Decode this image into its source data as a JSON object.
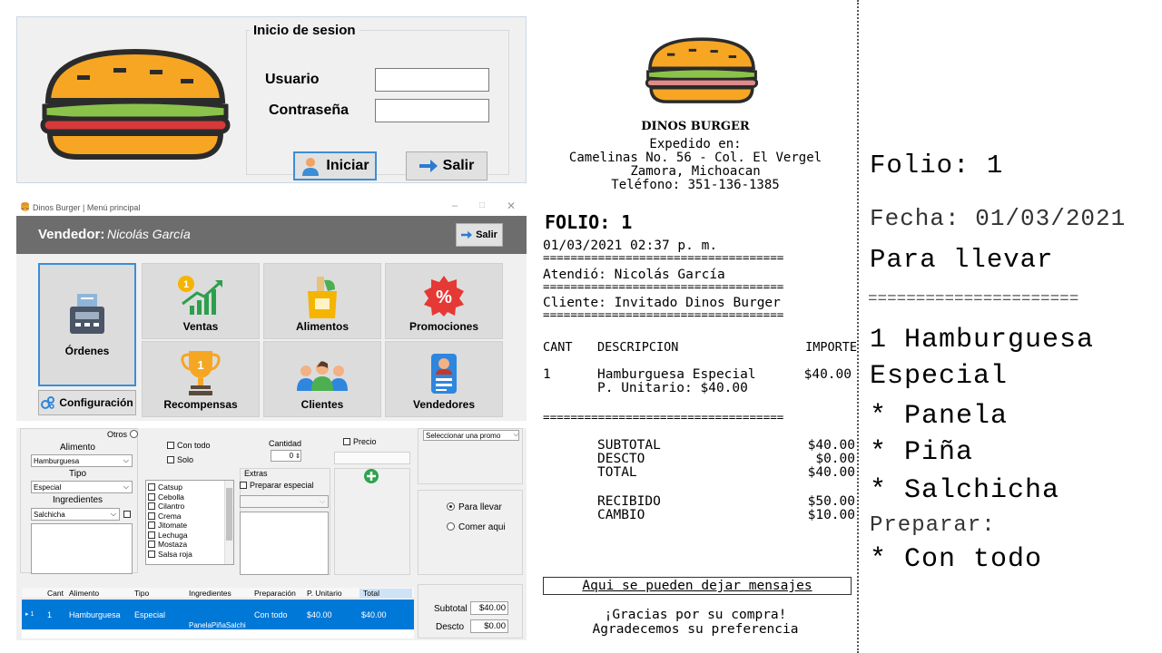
{
  "login": {
    "title": "Inicio de sesion",
    "user_label": "Usuario",
    "password_label": "Contraseña",
    "user_value": "",
    "password_value": "",
    "login_button": "Iniciar",
    "exit_button": "Salir"
  },
  "menu": {
    "window_title": "Dinos Burger | Menú principal",
    "seller_label": "Vendedor:",
    "seller_name": "Nicolás García",
    "exit_button": "Salir",
    "tiles": {
      "orders": "Órdenes",
      "sales": "Ventas",
      "sales_badge": "1",
      "foods": "Alimentos",
      "promos": "Promociones",
      "rewards": "Recompensas",
      "clients": "Clientes",
      "sellers": "Vendedores",
      "config": "Configuración"
    }
  },
  "order": {
    "otros_label": "Otros",
    "alimento_label": "Alimento",
    "alimento_value": "Hamburguesa",
    "tipo_label": "Tipo",
    "tipo_value": "Especial",
    "ingredientes_label": "Ingredientes",
    "ingrediente_value": "Salchicha",
    "con_todo": "Con todo",
    "solo": "Solo",
    "ingredients_list": [
      "Catsup",
      "Cebolla",
      "Cilantro",
      "Crema",
      "Jitomate",
      "Lechuga",
      "Mostaza",
      "Salsa roja"
    ],
    "cantidad_label": "Cantidad",
    "cantidad_value": "0",
    "extras_label": "Extras",
    "preparar_especial": "Preparar especial",
    "precio_label": "Precio",
    "promo_select": "Seleccionar una promo",
    "para_llevar": "Para llevar",
    "comer_aqui": "Comer aqui",
    "table_headers": [
      "Cant",
      "Alimento",
      "Tipo",
      "Ingredientes",
      "Preparación",
      "P. Unitario",
      "Total"
    ],
    "table_row": {
      "marker": "▸ 1",
      "cant": "1",
      "alimento": "Hamburguesa",
      "tipo": "Especial",
      "ingredientes": "PanelaPiñaSalchi",
      "preparacion": "Con todo",
      "unitario": "$40.00",
      "total": "$40.00"
    },
    "subtotal_label": "Subtotal",
    "subtotal_value": "$40.00",
    "descto_label": "Descto",
    "descto_value": "$0.00"
  },
  "receipt": {
    "brand": "DINOS BURGER",
    "expedido": "Expedido en:",
    "address1": "Camelinas No. 56 - Col. El Vergel",
    "address2": "Zamora, Michoacan",
    "phone": "Teléfono: 351-136-1385",
    "folio": "FOLIO: 1",
    "datetime": "01/03/2021 02:37 p. m.",
    "separator": "===================================",
    "atendio": "Atendió: Nicolás García",
    "cliente": "Cliente: Invitado Dinos Burger",
    "col_cant": "CANT",
    "col_desc": "DESCRIPCION",
    "col_importe": "IMPORTE",
    "item_cant": "1",
    "item_desc": "Hamburguesa Especial",
    "item_unit": "P. Unitario: $40.00",
    "item_importe": "$40.00",
    "subtotal_label": "SUBTOTAL",
    "subtotal_value": "$40.00",
    "descto_label": "DESCTO",
    "descto_value": "$0.00",
    "total_label": "TOTAL",
    "total_value": "$40.00",
    "recibido_label": "RECIBIDO",
    "recibido_value": "$50.00",
    "cambio_label": "CAMBIO",
    "cambio_value": "$10.00",
    "message": "Aqui se pueden dejar mensajes",
    "thanks1": "¡Gracias por su compra!",
    "thanks2": "Agradecemos su preferencia"
  },
  "kitchen": {
    "folio": "Folio: 1",
    "fecha": "Fecha: 01/03/2021",
    "modo": "Para llevar",
    "separator": "======================",
    "item_line1": "1 Hamburguesa",
    "item_line2": "Especial",
    "extra1": "* Panela",
    "extra2": "* Piña",
    "extra3": "* Salchicha",
    "preparar_label": "Preparar:",
    "preparar_value": "* Con todo"
  },
  "colors": {
    "accent_blue": "#0078d7",
    "header_gray": "#6d6d6d",
    "bun": "#f6a623",
    "lettuce": "#8bc34a",
    "meat": "#d63a3a"
  }
}
